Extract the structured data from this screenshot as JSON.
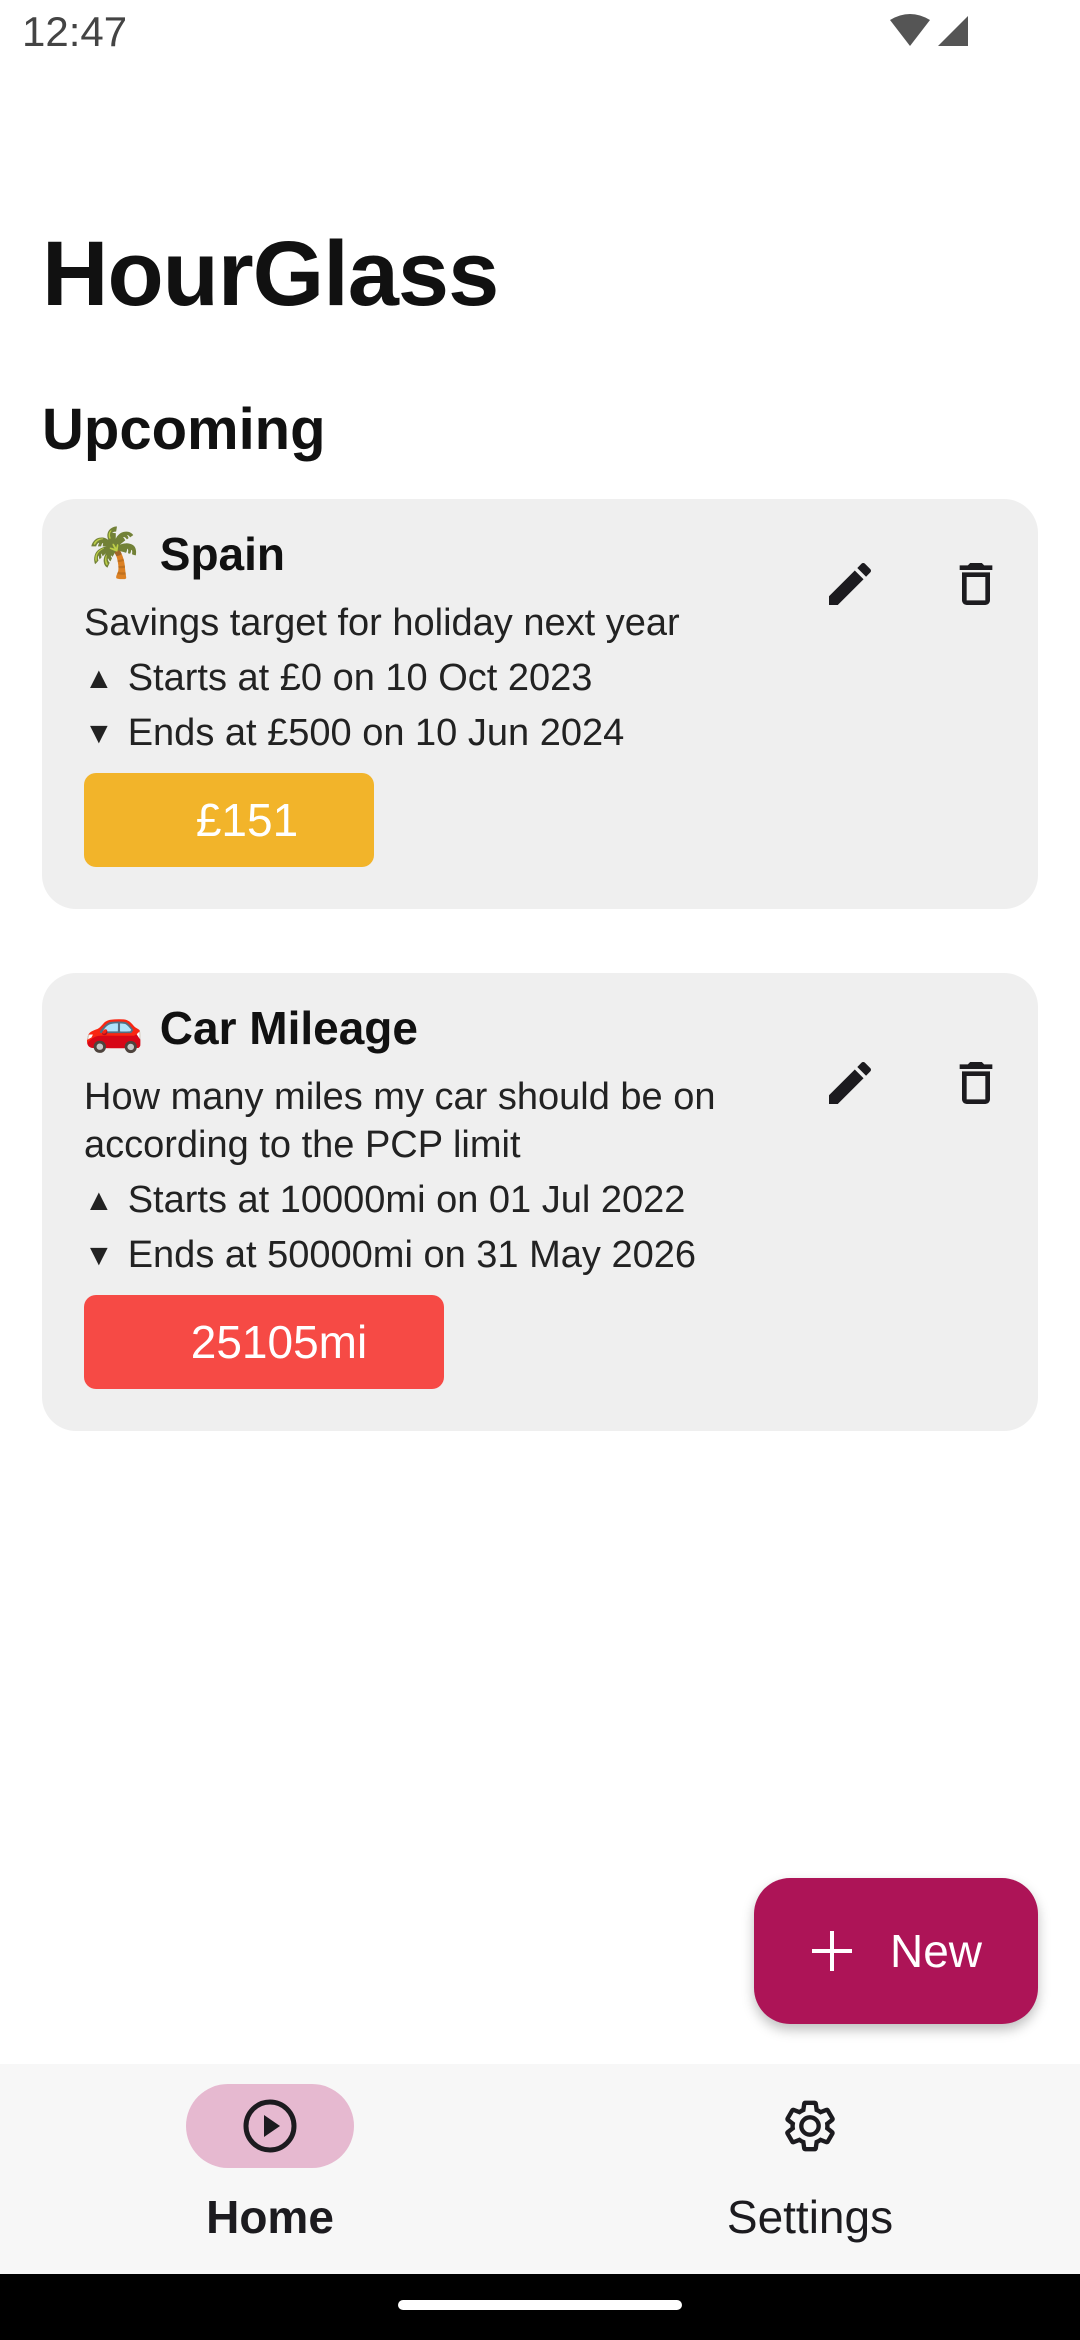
{
  "status_bar": {
    "time": "12:47"
  },
  "app": {
    "title": "HourGlass",
    "section_title": "Upcoming"
  },
  "cards": [
    {
      "emoji": "🌴",
      "title": "Spain",
      "description": "Savings target for holiday next year",
      "start_marker": "▲",
      "start": "Starts at £0 on 10 Oct 2023",
      "end_marker": "▼",
      "end": "Ends at £500 on 10 Jun 2024",
      "current_value": "£151",
      "badge_color": "#f2b42a"
    },
    {
      "emoji": "🚗",
      "title": "Car Mileage",
      "description": "How many miles my car should be on according to the PCP limit",
      "start_marker": "▲",
      "start": "Starts at 10000mi on 01 Jul 2022",
      "end_marker": "▼",
      "end": "Ends at 50000mi on 31 May 2026",
      "current_value": "25105mi",
      "badge_color": "#f64a45"
    }
  ],
  "fab": {
    "label": "New",
    "icon": "plus-icon",
    "color": "#ad1457"
  },
  "bottom_nav": {
    "items": [
      {
        "label": "Home",
        "icon": "play-circle-icon",
        "selected": true
      },
      {
        "label": "Settings",
        "icon": "gear-icon",
        "selected": false
      }
    ],
    "indicator_color": "#e6b9d0"
  }
}
